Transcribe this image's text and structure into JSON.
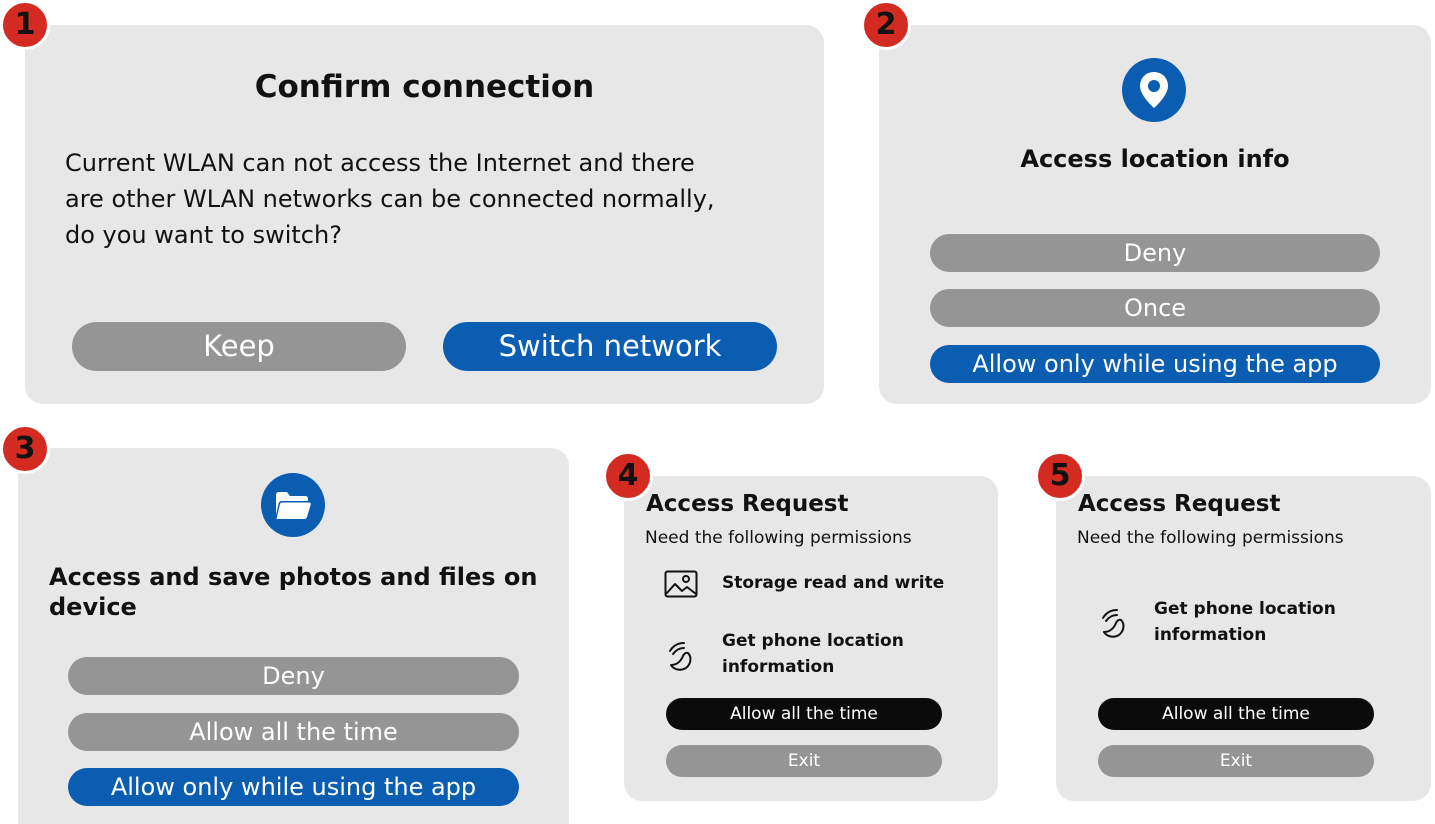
{
  "badges": [
    "1",
    "2",
    "3",
    "4",
    "5"
  ],
  "dialog1": {
    "title": "Confirm connection",
    "body_line1": "Current WLAN can not access the Internet and there",
    "body_line2": "are other WLAN networks can be connected normally,",
    "body_line3": "do you want to switch?",
    "keep_label": "Keep",
    "switch_label": "Switch network",
    "icon": null
  },
  "dialog2": {
    "icon": "location-pin-icon",
    "title": "Access location info",
    "deny_label": "Deny",
    "once_label": "Once",
    "allow_label": "Allow only while using the app"
  },
  "dialog3": {
    "icon": "folder-icon",
    "title_line1": "Access and save photos and files on",
    "title_line2": "device",
    "deny_label": "Deny",
    "allow_all_label": "Allow all the time",
    "allow_using_label": "Allow only while using the app"
  },
  "dialog4": {
    "title": "Access Request",
    "subtitle": "Need the following permissions",
    "perm_storage": "Storage read and write",
    "perm_location_line1": "Get phone location",
    "perm_location_line2": "information",
    "allow_label": "Allow all the time",
    "exit_label": "Exit"
  },
  "dialog5": {
    "title": "Access Request",
    "subtitle": "Need the following permissions",
    "perm_location_line1": "Get phone location",
    "perm_location_line2": "information",
    "allow_label": "Allow all the time",
    "exit_label": "Exit"
  },
  "colors": {
    "card": "#e7e7e7",
    "gray_button": "#959595",
    "blue_button": "#0a5db0",
    "black_button": "#0b0b0b",
    "badge": "#d32a22"
  }
}
